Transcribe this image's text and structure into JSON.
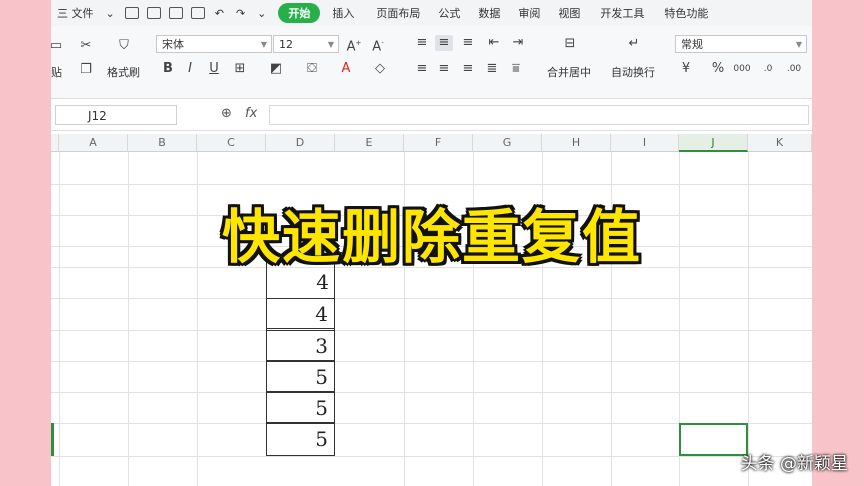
{
  "menubar": {
    "file": "三 文件",
    "tabs": [
      "开始",
      "插入",
      "页面布局",
      "公式",
      "数据",
      "审阅",
      "视图",
      "开发工具",
      "特色功能"
    ]
  },
  "ribbon": {
    "paste": "贴",
    "format_painter": "格式刷",
    "font": "宋体",
    "size": "12",
    "number_format": "常规",
    "merge": "合并居中",
    "wrap": "自动换行"
  },
  "formula": {
    "namebox": "J12",
    "fx": "fx"
  },
  "columns": [
    "A",
    "B",
    "C",
    "D",
    "E",
    "F",
    "G",
    "H",
    "I",
    "J",
    "K"
  ],
  "active_column": "J",
  "cells_d": [
    "4",
    "4",
    "3",
    "5",
    "5",
    "5"
  ],
  "overlay_title": "快速删除重复值",
  "watermark": "头条 @新颖星"
}
